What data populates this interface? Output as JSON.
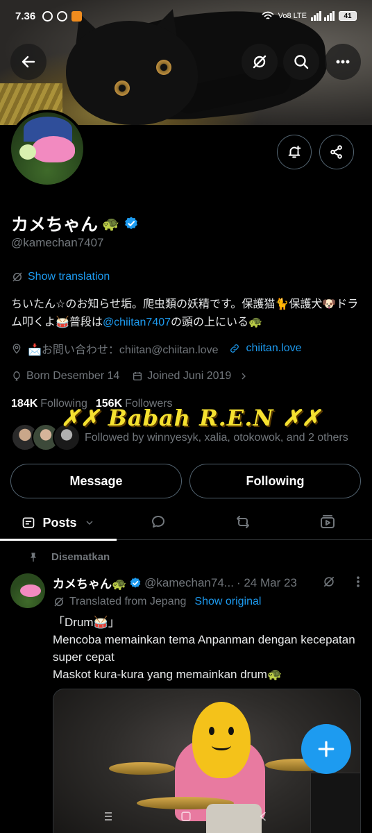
{
  "status_bar": {
    "time": "7.36",
    "network": "Vo8 LTE",
    "battery": "41"
  },
  "profile": {
    "name": "カメちゃん",
    "name_emoji": "🐢",
    "handle": "@kamechan7407",
    "show_translation": "Show translation",
    "bio_prefix": "ちいたん☆のお知らせ垢。爬虫類の妖精です。保護猫🐈保護犬🐶ドラム叩くよ🥁普段は",
    "bio_mention": "@chiitan7407",
    "bio_suffix": "の頭の上にいる🐢",
    "contact": "📩お問い合わせ：chiitan@chiitan.love",
    "website": "chiitan.love",
    "born": "Born Desember 14",
    "joined": "Joined Juni 2019",
    "following_count": "184K",
    "following_label": "Following",
    "followers_count": "156K",
    "followers_label": "Followers",
    "followed_by": "Followed by winnyesyk, xalia, otokowok, and 2 others",
    "overlay_text": "✗✗ Babah R.E.N ✗✗"
  },
  "buttons": {
    "message": "Message",
    "following": "Following"
  },
  "tabs": {
    "posts": "Posts"
  },
  "pinned_label": "Disematkan",
  "post": {
    "name": "カメちゃん🐢",
    "handle": "@kamechan74...",
    "date": "· 24 Mar 23",
    "translated_from": "Translated from Jepang",
    "show_original": "Show original",
    "line1": "「Drum🥁」",
    "line2": "Mencoba memainkan tema Anpanman dengan kecepatan super cepat",
    "line3": "Maskot kura-kura yang memainkan drum🐢"
  },
  "colors": {
    "accent": "#1d9bf0",
    "background": "#000000",
    "muted": "#71767b"
  },
  "icons": [
    "back-icon",
    "translate-off-icon",
    "search-icon",
    "more-icon",
    "notify-add-icon",
    "share-icon",
    "verified-icon",
    "location-icon",
    "link-icon",
    "balloon-icon",
    "calendar-icon",
    "chevron-right-icon",
    "posts-icon",
    "chevron-down-icon",
    "reply-icon",
    "repost-icon",
    "media-icon",
    "pin-icon",
    "plus-icon"
  ]
}
